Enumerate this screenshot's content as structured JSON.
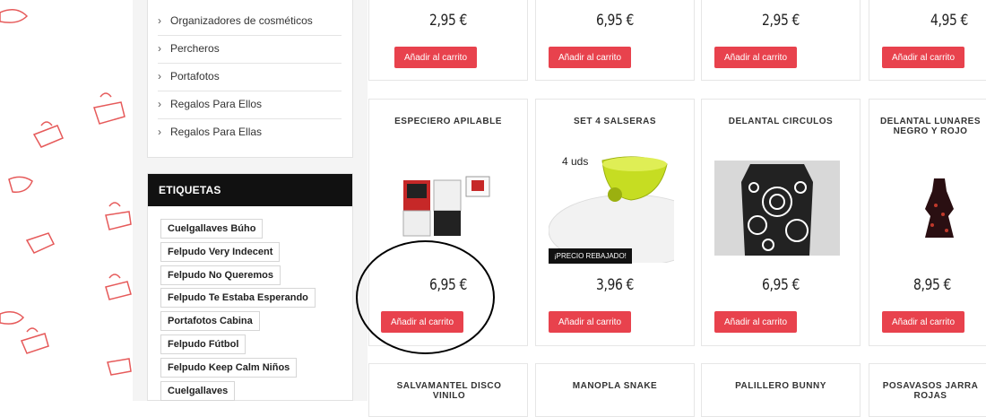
{
  "sidebar": {
    "categories": [
      {
        "label": "Organizadores de cosméticos"
      },
      {
        "label": "Percheros"
      },
      {
        "label": "Portafotos"
      },
      {
        "label": "Regalos Para Ellos"
      },
      {
        "label": "Regalos Para Ellas"
      }
    ],
    "tags_title": "ETIQUETAS",
    "tags": [
      "Cuelgallaves Búho",
      "Felpudo Very Indecent",
      "Felpudo No Queremos",
      "Felpudo Te Estaba Esperando",
      "Portafotos Cabina",
      "Felpudo Fútbol",
      "Felpudo Keep Calm Niños",
      "Cuelgallaves"
    ]
  },
  "products": {
    "row1": [
      {
        "price": "2,95 €",
        "button": "Añadir al carrito"
      },
      {
        "price": "6,95 €",
        "button": "Añadir al carrito"
      },
      {
        "price": "2,95 €",
        "button": "Añadir al carrito"
      },
      {
        "price": "4,95 €",
        "button": "Añadir al carrito"
      }
    ],
    "row2": [
      {
        "title": "ESPECIERO APILABLE",
        "price": "6,95 €",
        "button": "Añadir al carrito"
      },
      {
        "title": "SET 4 SALSERAS",
        "price": "3,96 €",
        "button": "Añadir al carrito",
        "image_text": "4 uds",
        "badge": "¡PRECIO REBAJADO!"
      },
      {
        "title": "DELANTAL CIRCULOS",
        "price": "6,95 €",
        "button": "Añadir al carrito"
      },
      {
        "title": "DELANTAL LUNARES NEGRO Y ROJO",
        "price": "8,95 €",
        "button": "Añadir al carrito"
      }
    ],
    "row3": [
      {
        "title": "SALVAMANTEL DISCO VINILO"
      },
      {
        "title": "MANOPLA SNAKE"
      },
      {
        "title": "PALILLERO BUNNY"
      },
      {
        "title": "POSAVASOS JARRA ROJAS"
      }
    ]
  },
  "colors": {
    "accent": "#e8424d",
    "header_bg": "#111111",
    "sidebar_bg": "#f4f4f4"
  }
}
